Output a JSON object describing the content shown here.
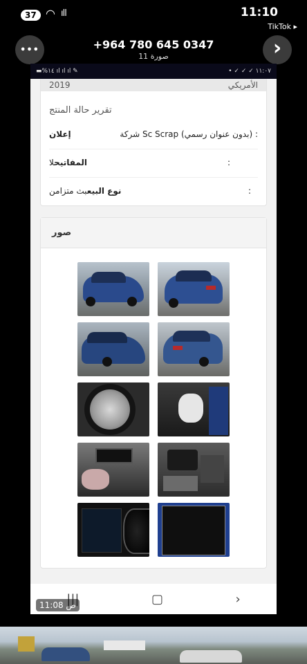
{
  "ios_status": {
    "badge": "37",
    "time": "11:10",
    "back_app": "TikTok ▸",
    "signal_glyph": "ıll",
    "wifi_glyph": "◠"
  },
  "chat_header": {
    "contact": "+964 780 645 0347",
    "subtitle": "11 صورة",
    "more_glyph": "•••",
    "next_glyph": "›"
  },
  "inner_status": {
    "left": "▬%١٤ ıl ıl ıl ✎",
    "right": "• ✓ ✓ ✓ ١١:٠٧"
  },
  "top_strip": {
    "year": "2019",
    "label": "الأمريكي"
  },
  "report": {
    "title": "تقرير حالة المنتج",
    "rows": [
      {
        "key": "إعلان",
        "value": "شركة Sc Scrap (بدون عنوان رسمي)",
        "colon": ":"
      },
      {
        "key": "المفاتيح",
        "value": "لا",
        "colon": ":"
      },
      {
        "key": "نوع البيع",
        "value": "بث متزامن",
        "colon": ":"
      }
    ]
  },
  "photos": {
    "heading": "صور",
    "count": 10
  },
  "nav": {
    "recents": "|||",
    "home": "▢",
    "back": "›",
    "timestamp": "11:08 ص"
  },
  "colors": {
    "car_blue": "#2a4a8c",
    "header_bg": "#3b3b3b",
    "page_bg": "#f2f2f2"
  }
}
